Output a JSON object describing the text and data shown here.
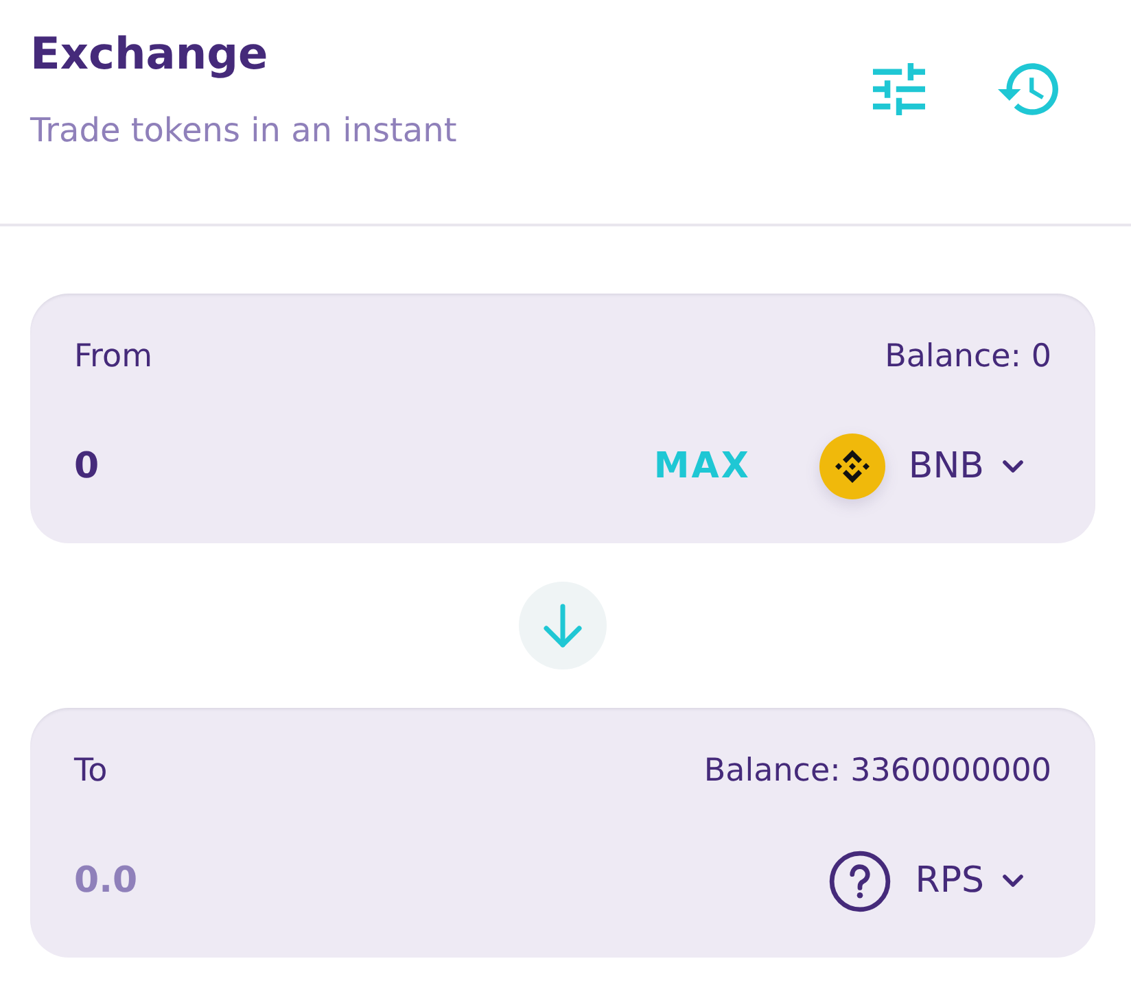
{
  "header": {
    "title": "Exchange",
    "subtitle": "Trade tokens in an instant"
  },
  "panels": [
    {
      "label": "From",
      "balance": "Balance: 0",
      "amount": {
        "value": "0"
      },
      "max_button": "MAX",
      "token": {
        "symbol": "BNB",
        "kind": "coin"
      }
    },
    {
      "label": "To",
      "balance": "Balance: 3360000000",
      "amount": {
        "placeholder": "0.0"
      },
      "token": {
        "symbol": "RPS",
        "kind": "unknown"
      }
    }
  ]
}
